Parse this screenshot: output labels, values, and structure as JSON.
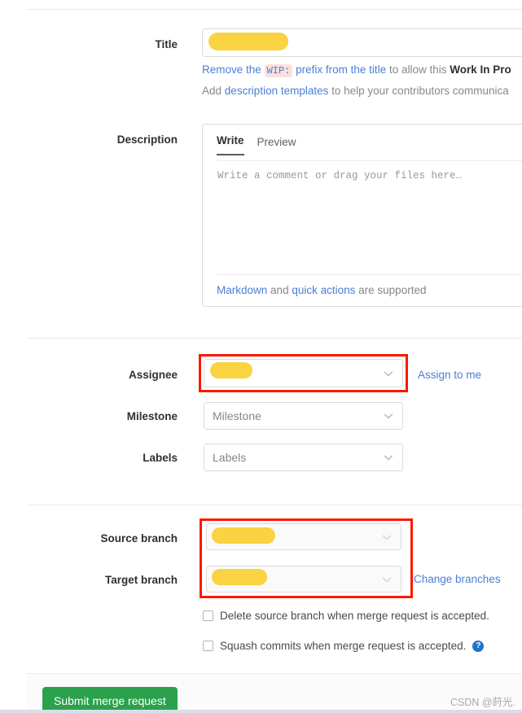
{
  "form": {
    "title_row": {
      "label": "Title",
      "value_redacted": true,
      "helper_1": {
        "link_1": "Remove the",
        "chip": "WIP:",
        "link_2": "prefix from the title",
        "mid": "to allow this",
        "bold": "Work In Pro"
      },
      "helper_2": {
        "prefix": "Add",
        "link": "description templates",
        "suffix": "to help your contributors communica"
      }
    },
    "description_row": {
      "label": "Description",
      "tabs": [
        {
          "label": "Write",
          "active": true
        },
        {
          "label": "Preview",
          "active": false
        }
      ],
      "placeholder": "Write a comment or drag your files here…",
      "footer": {
        "link_1": "Markdown",
        "mid": "and",
        "link_2": "quick actions",
        "suffix": "are supported"
      }
    },
    "assignee_row": {
      "label": "Assignee",
      "value_redacted": true,
      "action_link": "Assign to me",
      "annotated": true
    },
    "milestone_row": {
      "label": "Milestone",
      "placeholder": "Milestone"
    },
    "labels_row": {
      "label": "Labels",
      "placeholder": "Labels"
    },
    "source_branch_row": {
      "label": "Source branch",
      "value_redacted": true,
      "disabled": true
    },
    "target_branch_row": {
      "label": "Target branch",
      "value_redacted": true,
      "disabled": true,
      "action_link": "Change branches"
    },
    "checkboxes": [
      {
        "label": "Delete source branch when merge request is accepted.",
        "checked": false,
        "help_icon": false
      },
      {
        "label": "Squash commits when merge request is accepted.",
        "checked": false,
        "help_icon": true
      }
    ],
    "submit_label": "Submit merge request"
  },
  "watermark": "CSDN @莳光.",
  "colors": {
    "link": "#4a7fd6",
    "redaction": "#f9d341",
    "annotation": "#fc1800",
    "submit": "#2ba14e",
    "chip_bg": "#fbdfdd",
    "help_icon": "#1f75cb"
  }
}
